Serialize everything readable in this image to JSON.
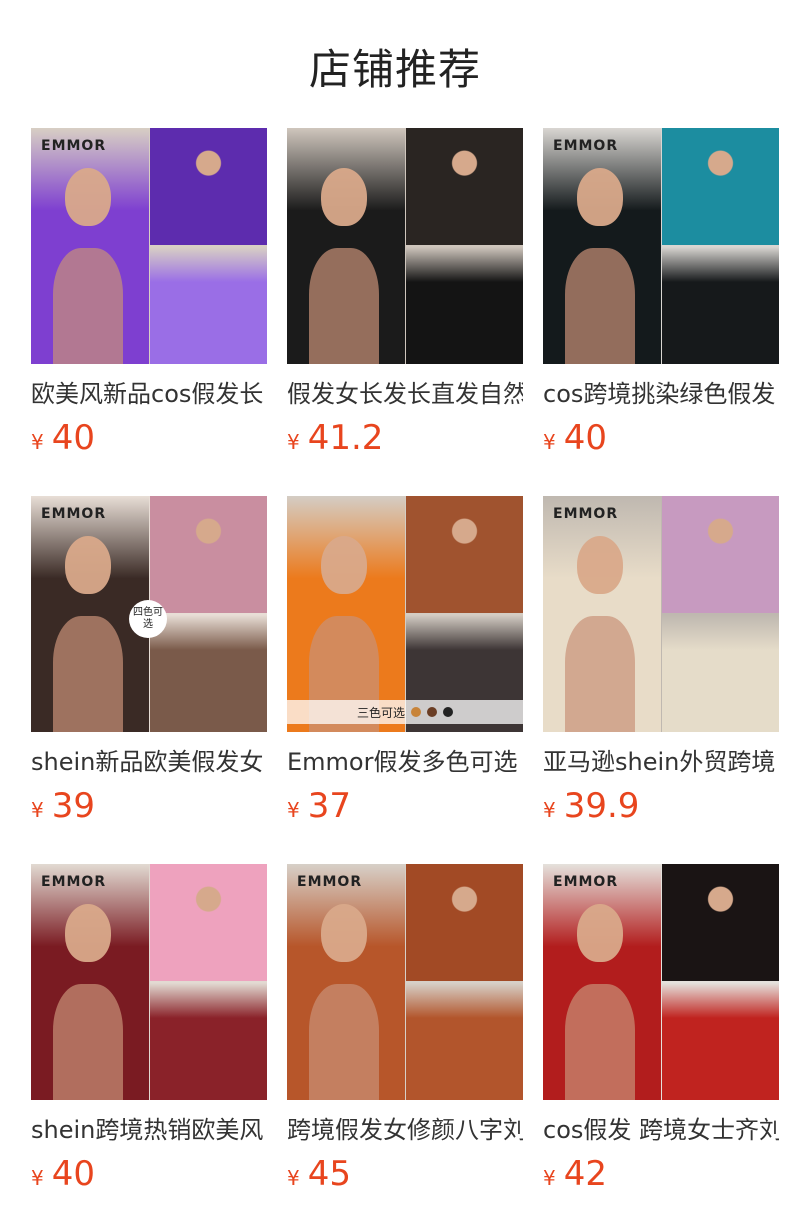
{
  "section_title": "店铺推荐",
  "currency_symbol": "¥",
  "products": [
    {
      "name": "欧美风新品cos假发长",
      "price": "40",
      "brand": "EMMOR",
      "colors": [
        "#7e3fd0",
        "#5d2cae",
        "#9a6ee6"
      ],
      "bg": "#d8cfc4"
    },
    {
      "name": "假发女长发长直发自然",
      "price": "41.2",
      "brand": "",
      "colors": [
        "#1b1b1b",
        "#2a2522",
        "#141414"
      ],
      "bg": "#cfc6bd"
    },
    {
      "name": "cos跨境挑染绿色假发",
      "price": "40",
      "brand": "EMMOR",
      "colors": [
        "#141a1c",
        "#1c8da0",
        "#16191b"
      ],
      "bg": "#d9d6d2"
    },
    {
      "name": "shein新品欧美假发女",
      "price": "39",
      "brand": "EMMOR",
      "colors": [
        "#3a2a25",
        "#c98ea0",
        "#7a5a4a"
      ],
      "bg": "#e8ded6",
      "badge": "四色可选"
    },
    {
      "name": "Emmor假发多色可选",
      "price": "37",
      "brand": "",
      "colors": [
        "#ec7a1c",
        "#a0532f",
        "#3d3535"
      ],
      "bg": "#d4cdc4",
      "color_label": "三色可选",
      "color_dots": [
        "#c8843a",
        "#6a3d24",
        "#222222"
      ]
    },
    {
      "name": "亚马逊shein外贸跨境",
      "price": "39.9",
      "brand": "EMMOR",
      "colors": [
        "#e8dcc8",
        "#c79ac0",
        "#e5dcc9"
      ],
      "bg": "#bfb8b0"
    },
    {
      "name": "shein跨境热销欧美风",
      "price": "40",
      "brand": "EMMOR",
      "colors": [
        "#7a1b22",
        "#eea2be",
        "#8a2229"
      ],
      "bg": "#e2dad2"
    },
    {
      "name": "跨境假发女修颜八字刘",
      "price": "45",
      "brand": "EMMOR",
      "colors": [
        "#b7562a",
        "#a24a25",
        "#b2552c"
      ],
      "bg": "#d7d0c8"
    },
    {
      "name": "cos假发 跨境女士齐刘",
      "price": "42",
      "brand": "EMMOR",
      "colors": [
        "#b21d1d",
        "#1a1414",
        "#c0231f"
      ],
      "bg": "#e5e1dc"
    }
  ]
}
